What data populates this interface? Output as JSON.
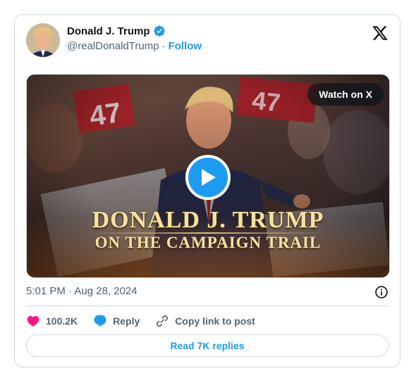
{
  "author": {
    "name": "Donald J. Trump",
    "handle": "@realDonaldTrump",
    "separator": "·",
    "follow_label": "Follow",
    "verified": true,
    "verified_color": "#1d9bf0"
  },
  "platform": {
    "logo_icon": "x-logo-icon"
  },
  "media": {
    "watch_label": "Watch on X",
    "caption_line1": "DONALD J. TRUMP",
    "caption_line2": "ON THE CAMPAIGN TRAIL",
    "play_icon": "play-icon",
    "sign_text": "47"
  },
  "meta": {
    "timestamp": "5:01 PM · Aug 28, 2024",
    "info_icon": "info-icon"
  },
  "actions": {
    "likes_count": "100.2K",
    "reply_label": "Reply",
    "copy_label": "Copy link to post",
    "like_color": "#f91880",
    "reply_color": "#1d9bf0"
  },
  "footer": {
    "read_replies_label": "Read 7K replies"
  }
}
